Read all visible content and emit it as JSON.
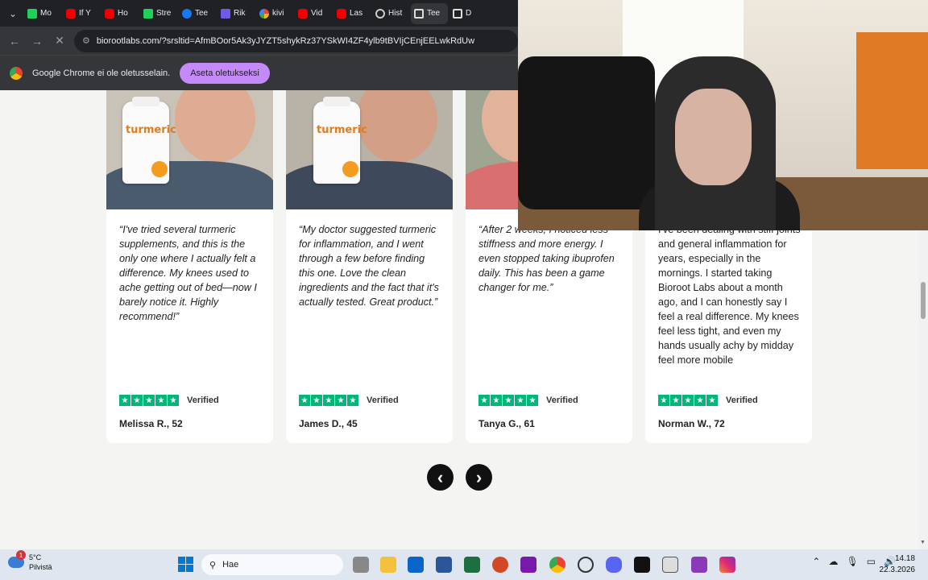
{
  "browser": {
    "tabs": [
      {
        "label": "Mo",
        "icon": "k-icon"
      },
      {
        "label": "If Y",
        "icon": "youtube-icon"
      },
      {
        "label": "Ho",
        "icon": "youtube-icon"
      },
      {
        "label": "Stre",
        "icon": "k-icon"
      },
      {
        "label": "Tee",
        "icon": "facebook-icon"
      },
      {
        "label": "Rik",
        "icon": "r-icon"
      },
      {
        "label": "kivi",
        "icon": "google-icon"
      },
      {
        "label": "Vid",
        "icon": "youtube-icon"
      },
      {
        "label": "Las",
        "icon": "youtube-icon"
      },
      {
        "label": "Hist",
        "icon": "history-icon"
      },
      {
        "label": "Tee",
        "icon": "d-icon"
      },
      {
        "label": "D",
        "icon": "d-icon"
      }
    ],
    "url": "biorootlabs.com/?srsltid=AfmBOor5Ak3yJYZT5shykRz37YSkWI4ZF4ylb9tBVIjCEnjEELwkRdUw",
    "infobar_text": "Google Chrome ei ole oletusselain.",
    "infobar_button": "Aseta oletukseksi"
  },
  "testimonials": [
    {
      "quote": "“I've tried several turmeric supplements, and this is the only one where I actually felt a difference. My knees used to ache getting out of bed—now I barely notice it. Highly recommend!”",
      "author": "Melissa R., 52",
      "verified": "Verified",
      "bottle_label": "turmeric",
      "stars": 5
    },
    {
      "quote": "“My doctor suggested turmeric for inflammation, and I went through a few before finding this one. Love the clean ingredients and the fact that it's actually tested. Great product.”",
      "author": "James D., 45",
      "verified": "Verified",
      "bottle_label": "turmeric",
      "stars": 5
    },
    {
      "quote": "“After 2 weeks, I noticed less stiffness and more energy. I even stopped taking ibuprofen daily. This has been a game changer for me.”",
      "author": "Tanya G., 61",
      "verified": "Verified",
      "stars": 5
    },
    {
      "quote": "I've been dealing with stiff joints and general inflammation for years, especially in the mornings. I started taking Bioroot Labs about a month ago, and I can honestly say I feel a real difference. My knees feel less tight, and even my hands usually achy by midday feel more mobile",
      "author": "Norman W., 72",
      "verified": "Verified",
      "stars": 5
    }
  ],
  "carousel": {
    "prev_icon": "‹",
    "next_icon": "›"
  },
  "taskbar": {
    "weather_temp": "5°C",
    "weather_desc": "Pilvistä",
    "weather_badge": "1",
    "search_placeholder": "Hae",
    "time": "14.18",
    "date": "22.3.2026"
  },
  "colors": {
    "star_green": "#00b67a",
    "button_purple": "#c58af9",
    "chrome_dark": "#202124"
  }
}
